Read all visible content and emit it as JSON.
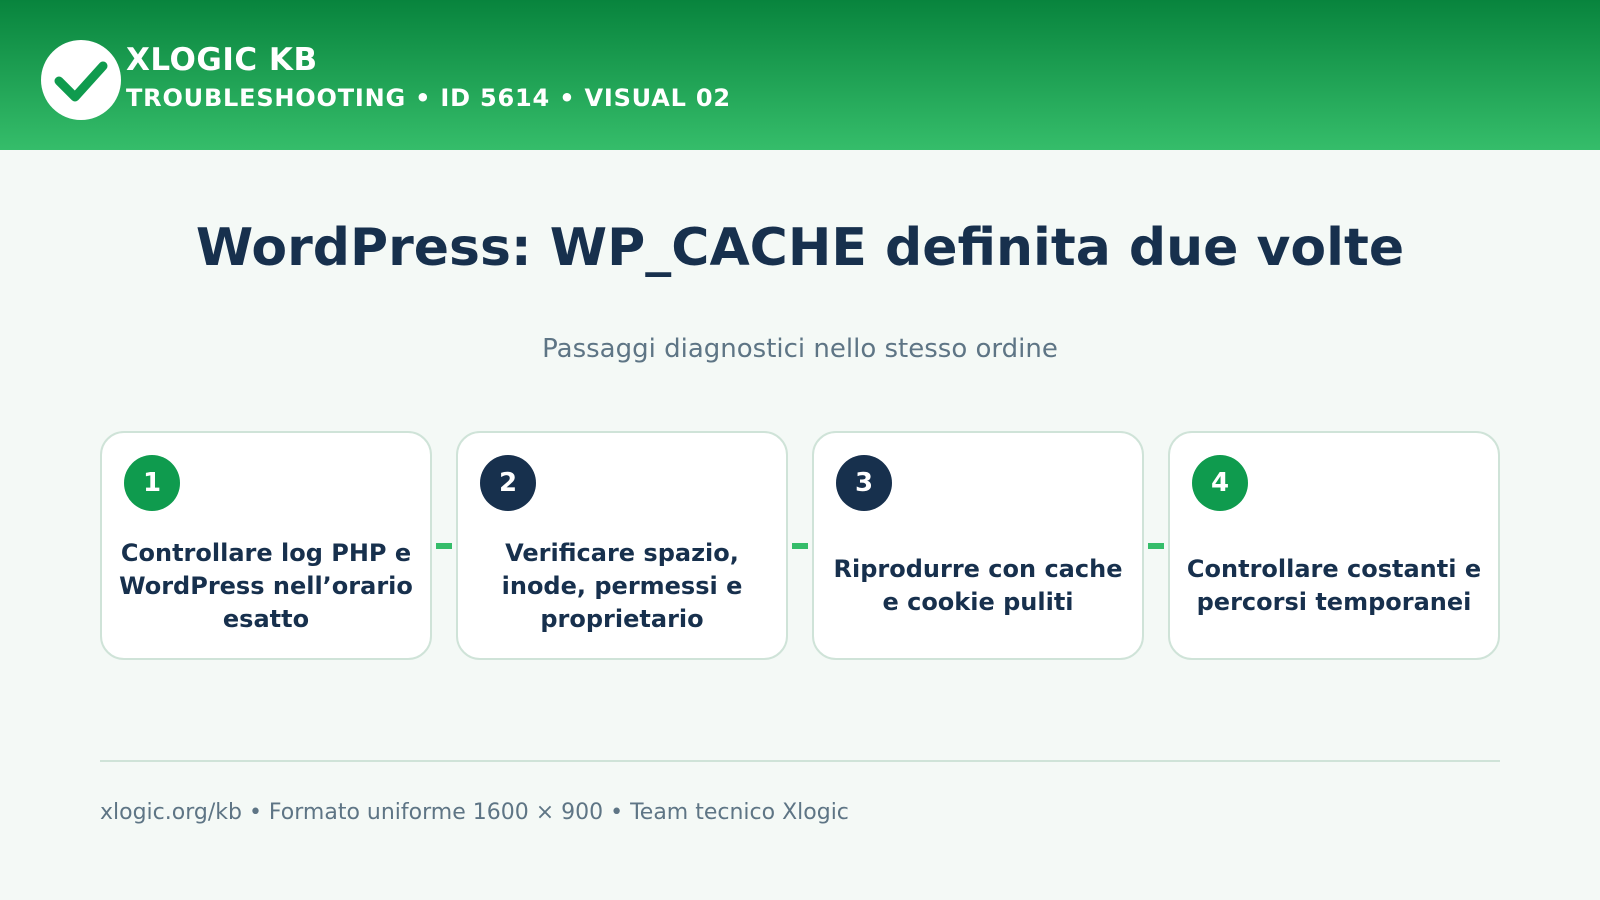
{
  "header": {
    "brand": "XLOGIC KB",
    "subtitle": "TROUBLESHOOTING • ID 5614 • VISUAL 02",
    "logo_icon": "check-icon",
    "background_color": "#08843d",
    "gradient_end_color": "#35bd6a"
  },
  "main": {
    "title": "WordPress: WP_CACHE definita due volte",
    "subtitle": "Passaggi diagnostici nello stesso ordine"
  },
  "steps": [
    {
      "number": "1",
      "text": "Controllare log PHP e WordPress nell’orario esatto",
      "badge_color": "#0f9b4e"
    },
    {
      "number": "2",
      "text": "Verificare spazio, inode, permessi e proprietario",
      "badge_color": "#17304d"
    },
    {
      "number": "3",
      "text": "Riprodurre con cache e cookie puliti",
      "badge_color": "#17304d"
    },
    {
      "number": "4",
      "text": "Controllare costanti e percorsi temporanei",
      "badge_color": "#0f9b4e"
    }
  ],
  "footer": {
    "text": "xlogic.org/kb • Formato uniforme 1600 × 900 • Team tecnico Xlogic"
  }
}
